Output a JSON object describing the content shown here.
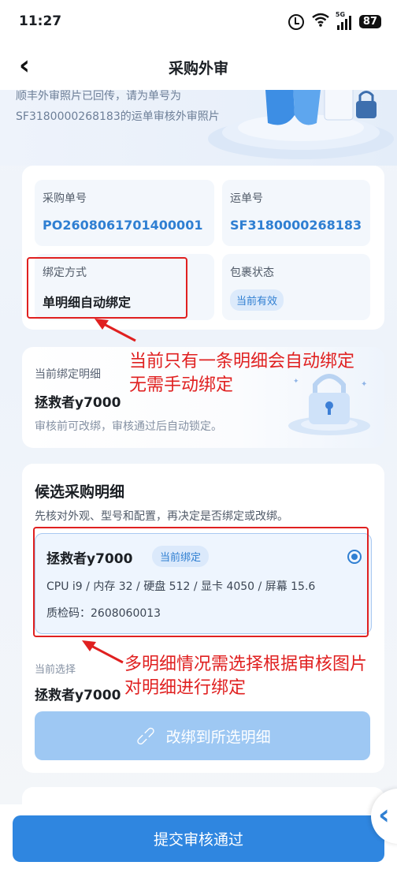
{
  "status_bar": {
    "time": "11:27",
    "network": "5G",
    "battery": "87"
  },
  "header": {
    "title": "采购外审"
  },
  "banner": {
    "text": "顺丰外审照片已回传，请为单号为SF3180000268183的运单审核外审照片"
  },
  "binding_info": {
    "purchase_no_label": "采购单号",
    "purchase_no": "PO2608061701400001",
    "waybill_no_label": "运单号",
    "waybill_no": "SF3180000268183",
    "bind_method_label": "绑定方式",
    "bind_method": "单明细自动绑定",
    "package_status_label": "包裹状态",
    "package_status": "当前有效"
  },
  "current_binding": {
    "label": "当前绑定明细",
    "name": "拯救者y7000",
    "hint": "审核前可改绑，审核通过后自动锁定。"
  },
  "candidates": {
    "title": "候选采购明细",
    "desc": "先核对外观、型号和配置，再决定是否绑定或改绑。",
    "items": [
      {
        "name": "拯救者y7000",
        "badge": "当前绑定",
        "spec": "CPU i9 / 内存 32 / 硬盘 512 / 显卡 4050 / 屏幕 15.6",
        "qc": "质检码：2608060013",
        "selected": true
      }
    ],
    "current_selection_label": "当前选择",
    "current_selection": "拯救者y7000",
    "rebind_button": "改绑到所选明细"
  },
  "footer": {
    "submit_button": "提交审核通过"
  },
  "annotations": {
    "note1_line1": "当前只有一条明细会自动绑定",
    "note1_line2": "无需手动绑定",
    "note2_line1": "多明细情况需选择根据审核图片",
    "note2_line2": "对明细进行绑定",
    "color": "#e02020"
  },
  "colors": {
    "accent": "#2f86e0",
    "accent_light": "#9ec8f3"
  }
}
